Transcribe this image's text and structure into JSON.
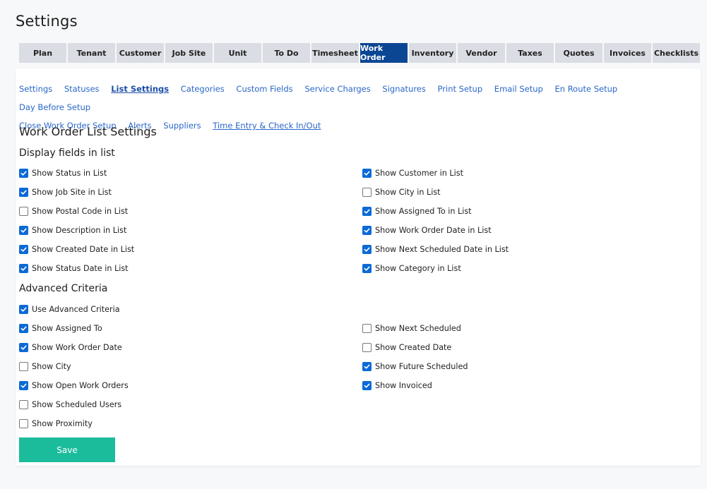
{
  "page": {
    "title": "Settings"
  },
  "tabs": [
    {
      "label": "Plan"
    },
    {
      "label": "Tenant"
    },
    {
      "label": "Customer"
    },
    {
      "label": "Job Site"
    },
    {
      "label": "Unit"
    },
    {
      "label": "To Do"
    },
    {
      "label": "Timesheet"
    },
    {
      "label": "Work Order"
    },
    {
      "label": "Inventory"
    },
    {
      "label": "Vendor"
    },
    {
      "label": "Taxes"
    },
    {
      "label": "Quotes"
    },
    {
      "label": "Invoices"
    },
    {
      "label": "Checklists"
    }
  ],
  "active_tab": "Work Order",
  "subnav": [
    {
      "label": "Settings"
    },
    {
      "label": "Statuses"
    },
    {
      "label": "List Settings"
    },
    {
      "label": "Categories"
    },
    {
      "label": "Custom Fields"
    },
    {
      "label": "Service Charges"
    },
    {
      "label": "Signatures"
    },
    {
      "label": "Print Setup"
    },
    {
      "label": "Email Setup"
    },
    {
      "label": "En Route Setup"
    },
    {
      "label": "Day Before Setup"
    },
    {
      "label": "Close Work Order Setup"
    },
    {
      "label": "Alerts"
    },
    {
      "label": "Suppliers"
    },
    {
      "label": "Time Entry & Check In/Out"
    }
  ],
  "main": {
    "title": "Work Order List Settings",
    "display_heading": "Display fields in list",
    "advanced_heading": "Advanced Criteria",
    "save_label": "Save"
  },
  "display_fields": [
    {
      "label": "Show Status in List",
      "checked": true
    },
    {
      "label": "Show Customer in List",
      "checked": true
    },
    {
      "label": "Show Job Site in List",
      "checked": true
    },
    {
      "label": "Show City in List",
      "checked": false
    },
    {
      "label": "Show Postal Code in List",
      "checked": false
    },
    {
      "label": "Show Assigned To in List",
      "checked": true
    },
    {
      "label": "Show Description in List",
      "checked": true
    },
    {
      "label": "Show Work Order Date in List",
      "checked": true
    },
    {
      "label": "Show Created Date in List",
      "checked": true
    },
    {
      "label": "Show Next Scheduled Date in List",
      "checked": true
    },
    {
      "label": "Show Status Date in List",
      "checked": true
    },
    {
      "label": "Show Category in List",
      "checked": true
    }
  ],
  "advanced_fields": [
    {
      "label": "Use Advanced Criteria",
      "checked": true
    },
    {
      "label": "Show Assigned To",
      "checked": true
    },
    {
      "label": "Show Next Scheduled",
      "checked": false
    },
    {
      "label": "Show Work Order Date",
      "checked": true
    },
    {
      "label": "Show Created Date",
      "checked": false
    },
    {
      "label": "Show City",
      "checked": false
    },
    {
      "label": "Show Future Scheduled",
      "checked": true
    },
    {
      "label": "Show Open Work Orders",
      "checked": true
    },
    {
      "label": "Show Invoiced",
      "checked": true
    },
    {
      "label": "Show Scheduled Users",
      "checked": false
    },
    {
      "label": "Show Proximity",
      "checked": false
    }
  ],
  "colors": {
    "active_tab": "#0b4694",
    "tab": "#dadde3",
    "link": "#2a67c9",
    "checkbox": "#0b6ad6",
    "save_button": "#1bbc9b"
  }
}
